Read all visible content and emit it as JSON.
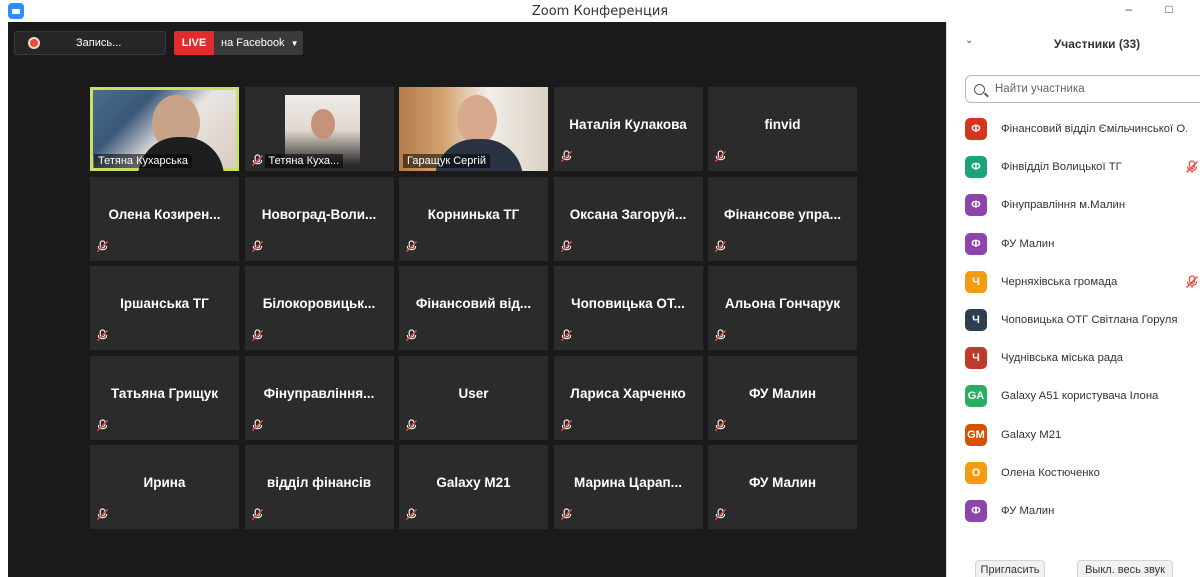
{
  "window": {
    "title": "Zoom Конференция"
  },
  "toolbar": {
    "recording_label": "Запись...",
    "live_badge": "LIVE",
    "live_destination": "на Facebook"
  },
  "tiles": [
    {
      "name": "Тетяна Кухарська",
      "video": true
    },
    {
      "name": "Тетяна Куха...",
      "video": true
    },
    {
      "name": "Гаращук Сергій",
      "video": true
    },
    {
      "name": "Наталія  Кулакова"
    },
    {
      "name": "finvid"
    },
    {
      "name": "Олена  Козирен..."
    },
    {
      "name": "Новоград-Воли..."
    },
    {
      "name": "Корнинька ТГ"
    },
    {
      "name": "Оксана  Загоруй..."
    },
    {
      "name": "Фінансове  упра..."
    },
    {
      "name": "Іршанська ТГ"
    },
    {
      "name": "Білокоровицьк..."
    },
    {
      "name": "Фінансовий  від..."
    },
    {
      "name": "Чоповицька  ОТ..."
    },
    {
      "name": "Альона Гончарук"
    },
    {
      "name": "Татьяна Грищук"
    },
    {
      "name": "Фінуправління..."
    },
    {
      "name": "User"
    },
    {
      "name": "Лариса Харченко"
    },
    {
      "name": "ФУ Малин"
    },
    {
      "name": "Ирина"
    },
    {
      "name": "відділ фінансів"
    },
    {
      "name": "Galaxy M21"
    },
    {
      "name": "Марина  Царап..."
    },
    {
      "name": "ФУ Малин"
    }
  ],
  "panel": {
    "title": "Участники (33)",
    "search_placeholder": "Найти участника",
    "participants": [
      {
        "initial": "Ф",
        "color": "#d4351c",
        "name": "Фінансовий відділ Ємільчинської О...",
        "muted": false
      },
      {
        "initial": "Ф",
        "color": "#1aa37a",
        "name": "Фінвідділ Волицької ТГ",
        "muted": true
      },
      {
        "initial": "Ф",
        "color": "#8e44ad",
        "name": "Фінуправління м.Малин",
        "muted": false
      },
      {
        "initial": "Ф",
        "color": "#8e44ad",
        "name": "ФУ Малин",
        "muted": false
      },
      {
        "initial": "Ч",
        "color": "#f39c12",
        "name": "Черняхівська громада",
        "muted": true
      },
      {
        "initial": "Ч",
        "color": "#2c3e50",
        "name": "Чоповицька ОТГ Світлана Горуля",
        "muted": false
      },
      {
        "initial": "Ч",
        "color": "#c0392b",
        "name": "Чуднівська міська рада",
        "muted": false
      },
      {
        "initial": "GA",
        "color": "#27ae60",
        "name": "Galaxy A51 користувача Ілона",
        "muted": false
      },
      {
        "initial": "GM",
        "color": "#d35400",
        "name": "Galaxy M21",
        "muted": false
      },
      {
        "initial": "О",
        "color": "#f39c12",
        "name": "Олена Костюченко",
        "muted": false
      },
      {
        "initial": "Ф",
        "color": "#8e44ad",
        "name": "ФУ Малин",
        "muted": false
      }
    ],
    "invite_label": "Пригласить",
    "mute_all_label": "Выкл. весь звук"
  }
}
